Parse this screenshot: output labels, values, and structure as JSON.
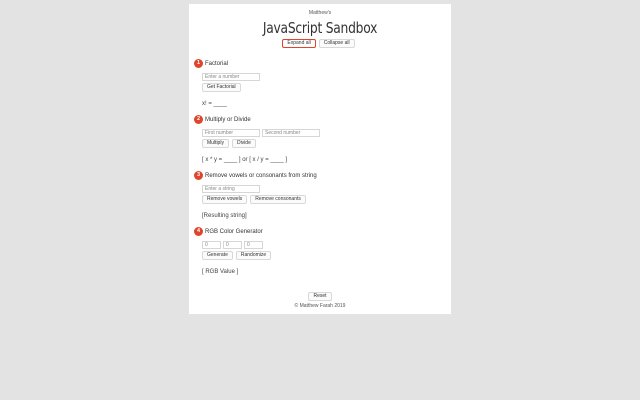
{
  "header": {
    "subtitle": "Matthew's",
    "title": "JavaScript Sandbox",
    "expand_label": "Expand all",
    "collapse_label": "Collapse all"
  },
  "sections": [
    {
      "number": "1",
      "title": "Factorial",
      "inputs": [
        {
          "placeholder": "Enter a number"
        }
      ],
      "buttons": [
        {
          "label": "Get Factorial"
        }
      ],
      "result": "x! = ____"
    },
    {
      "number": "2",
      "title": "Multiply or Divide",
      "inputs": [
        {
          "placeholder": "First number"
        },
        {
          "placeholder": "Second number"
        }
      ],
      "buttons": [
        {
          "label": "Multiply"
        },
        {
          "label": "Divide"
        }
      ],
      "result": "[ x * y = ____ ] or [ x / y = ____ ]"
    },
    {
      "number": "3",
      "title": "Remove vowels or consonants from string",
      "inputs": [
        {
          "placeholder": "Enter a string"
        }
      ],
      "buttons": [
        {
          "label": "Remove vowels"
        },
        {
          "label": "Remove consonants"
        }
      ],
      "result": "[Resulting string]"
    },
    {
      "number": "4",
      "title": "RGB Color Generator",
      "inputs": [
        {
          "placeholder": "0"
        },
        {
          "placeholder": "0"
        },
        {
          "placeholder": "0"
        }
      ],
      "buttons": [
        {
          "label": "Generate"
        },
        {
          "label": "Randomize"
        }
      ],
      "result": "[ RGB Value ]"
    }
  ],
  "footer": {
    "reset_label": "Reset",
    "copyright": "© Matthew Farah 2019"
  },
  "colors": {
    "accent": "#e0442b",
    "page_background": "#e3e3e3",
    "card_background": "#ffffff"
  }
}
